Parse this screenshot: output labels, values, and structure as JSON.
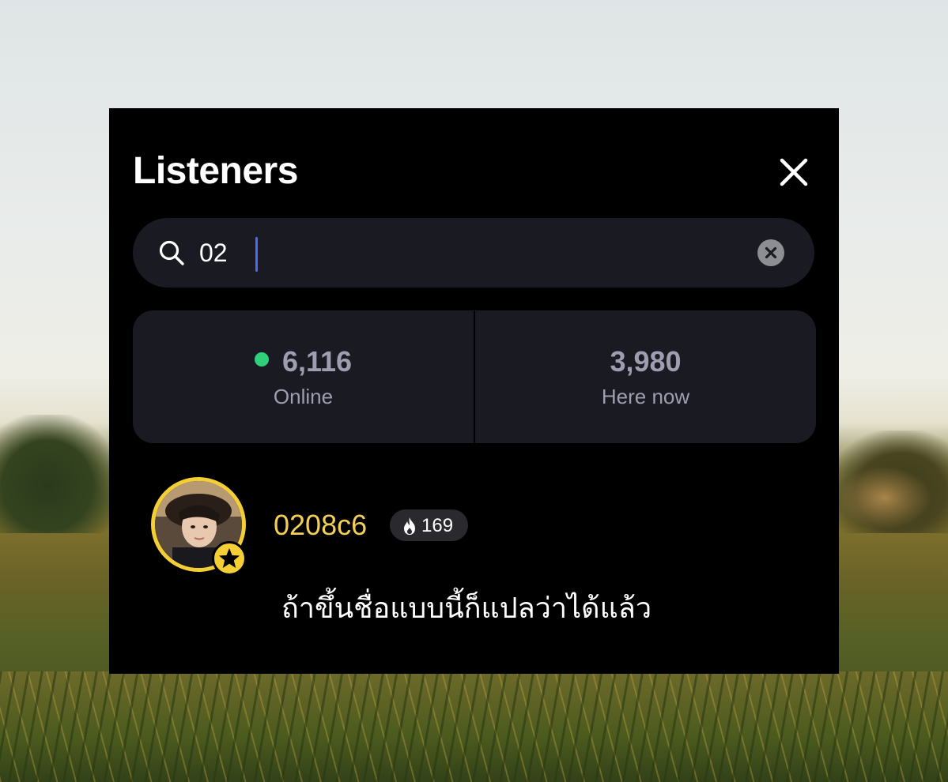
{
  "panel": {
    "title": "Listeners",
    "close_icon": "close-icon"
  },
  "search": {
    "icon": "search-icon",
    "value": "02",
    "clear_icon": "clear-icon"
  },
  "stats": {
    "online": {
      "value": "6,116",
      "label": "Online",
      "status_color": "#2fd07a"
    },
    "here_now": {
      "value": "3,980",
      "label": "Here now"
    }
  },
  "listener": {
    "username": "0208c6",
    "username_color": "#f3cf57",
    "fire_icon": "fire-icon",
    "fire_count": "169",
    "badge_icon": "star-icon"
  },
  "caption": "ถ้าขึ้นชื่อแบบนี้ก็แปลว่าได้แล้ว"
}
